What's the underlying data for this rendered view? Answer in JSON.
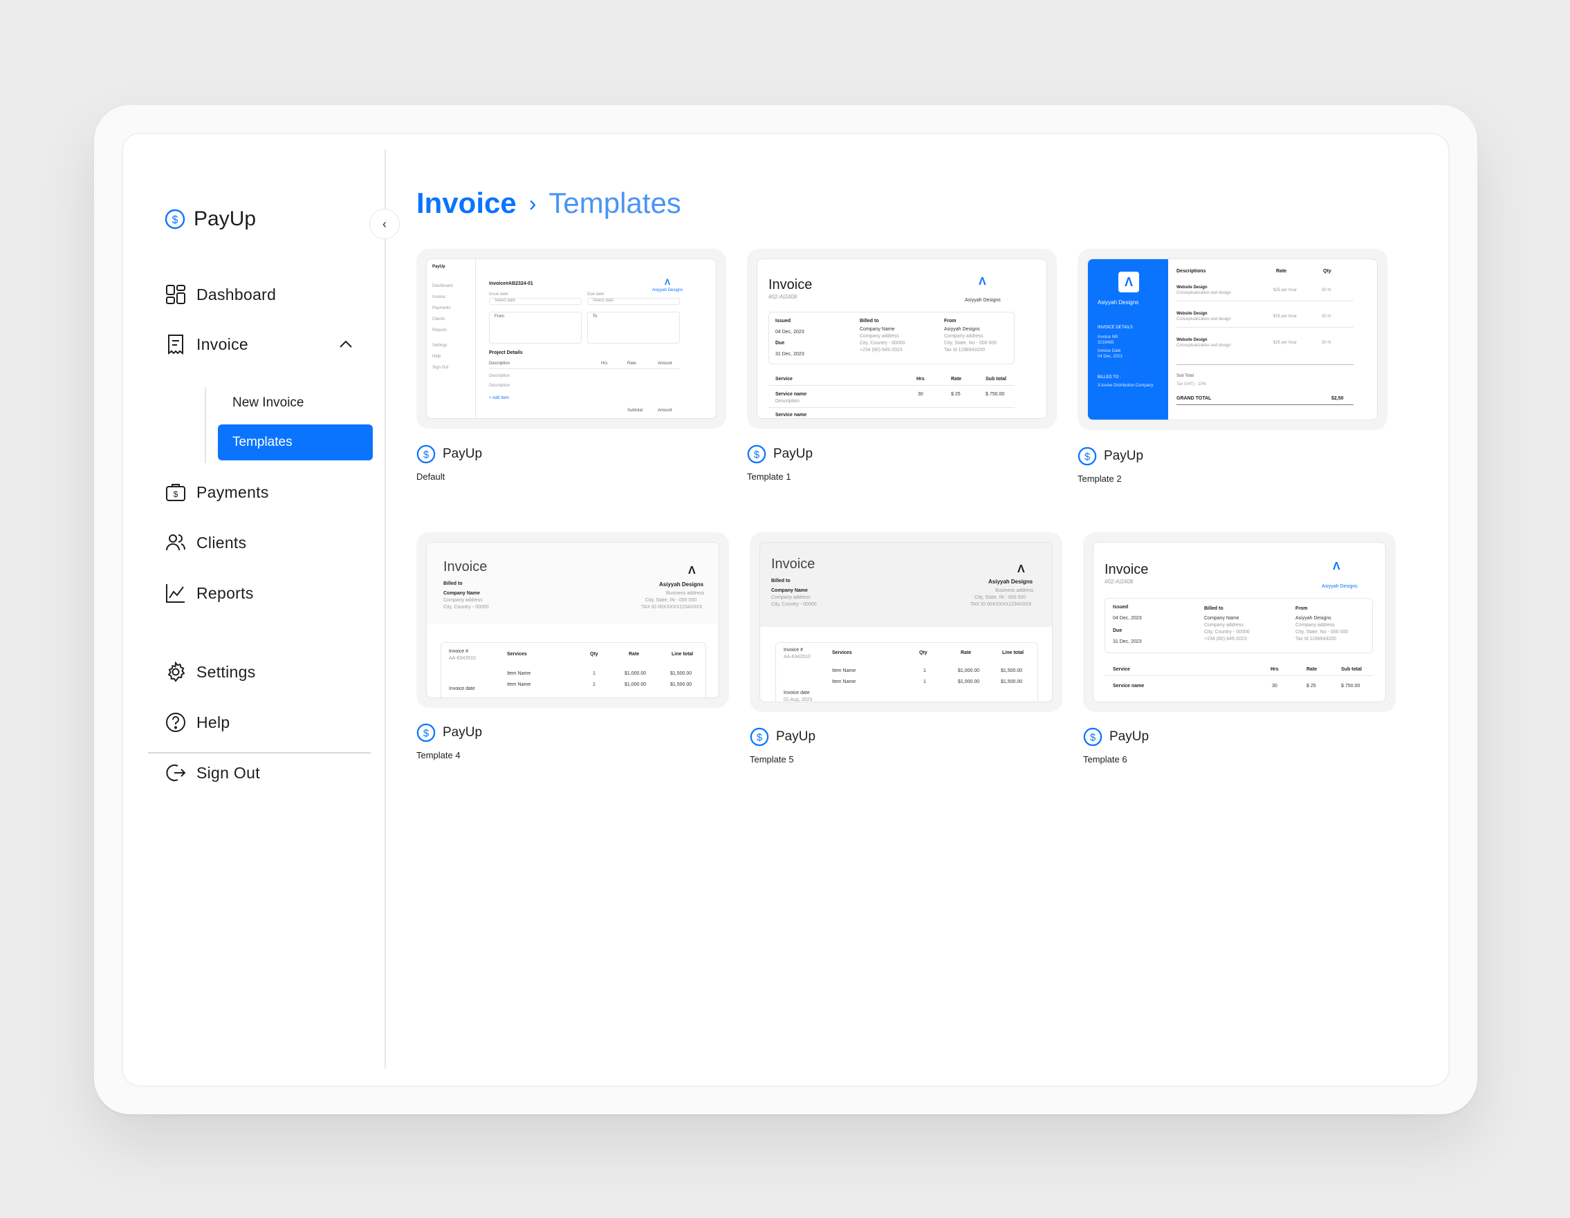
{
  "brand": "PayUp",
  "nav": {
    "dashboard": "Dashboard",
    "invoice": "Invoice",
    "new_invoice": "New Invoice",
    "templates": "Templates",
    "payments": "Payments",
    "clients": "Clients",
    "reports": "Reports",
    "settings": "Settings",
    "help": "Help",
    "sign_out": "Sign Out"
  },
  "breadcrumb": {
    "parent": "Invoice",
    "current": "Templates"
  },
  "colors": {
    "accent": "#0a74ff",
    "accent_light": "#4a94f6"
  },
  "templates": [
    {
      "name": "Default",
      "brand": "PayUp"
    },
    {
      "name": "Template 1",
      "brand": "PayUp"
    },
    {
      "name": "Template 2",
      "brand": "PayUp"
    },
    {
      "name": "Template 4",
      "brand": "PayUp"
    },
    {
      "name": "Template 5",
      "brand": "PayUp"
    },
    {
      "name": "Template 6",
      "brand": "PayUp"
    }
  ],
  "preview": {
    "invoice_title": "Invoice",
    "invoice_no": "#02-AI2408",
    "default_no": "Invoice#AB2324-01",
    "company_logo": "Asiyyah Designs",
    "issued_label": "Issued",
    "issued_date": "04 Dec, 2023",
    "due_label": "Due",
    "due_date": "31 Dec, 2023",
    "billed_to": "Billed to",
    "company_name": "Company Name",
    "company_address": "Company address",
    "city_country": "City, Country - 00000",
    "phone": "+234 (80) 645-2023",
    "from": "From",
    "from_city": "City, State, No - 000 000",
    "tax_id": "Tax Id 1198943200",
    "business_address": "Business address",
    "tax_long": "TAX ID 00XXXXX1234X0XX",
    "city_state": "City, State, IN - 000 000",
    "service": "Service",
    "services": "Services",
    "hrs": "Hrs",
    "rate": "Rate",
    "qty": "Qty",
    "subtotal_h": "Sub total",
    "line_total": "Line total",
    "service_name": "Service name",
    "description": "Description",
    "desc_plural": "Descriptions",
    "hrs_val": "30",
    "rate_val": "$ 25",
    "amount_val": "$ 750.00",
    "invoice_num_label": "Invoice #",
    "invoice_num": "AA-6342610",
    "invoice_date": "Invoice date",
    "invoice_date_val": "01 Aug, 2023",
    "item_name": "Item Name",
    "item_qty": "1",
    "item_rate": "$1,000.00",
    "item_total": "$1,500.00",
    "website_design": "Website Design",
    "website_desc": "Conceptualization and design",
    "per_hour": "$25 per hour",
    "hr30": "30 hr",
    "invoice_details": "INVOICE DETAILS",
    "invoice_no_label": "Invoice NR.",
    "invoice_no_val": "3216465",
    "invoice_date_label": "Invoice Date",
    "billed_to_caps": "BILLED TO :",
    "billed_company": "X-lusive Distribution Company",
    "sub_total": "Sub Total",
    "tax_label": "Tax (VAT) - 10%",
    "grand_total": "GRAND TOTAL",
    "total_val": "$2,50",
    "project_details": "Project Details",
    "add_item": "+ Add Item",
    "amount": "Amount",
    "issue_date": "Issue date",
    "due_date_lbl": "Due date",
    "select_date": "Select date",
    "from_lbl": "From",
    "to_lbl": "To",
    "subtotal_word": "Subtotal"
  }
}
